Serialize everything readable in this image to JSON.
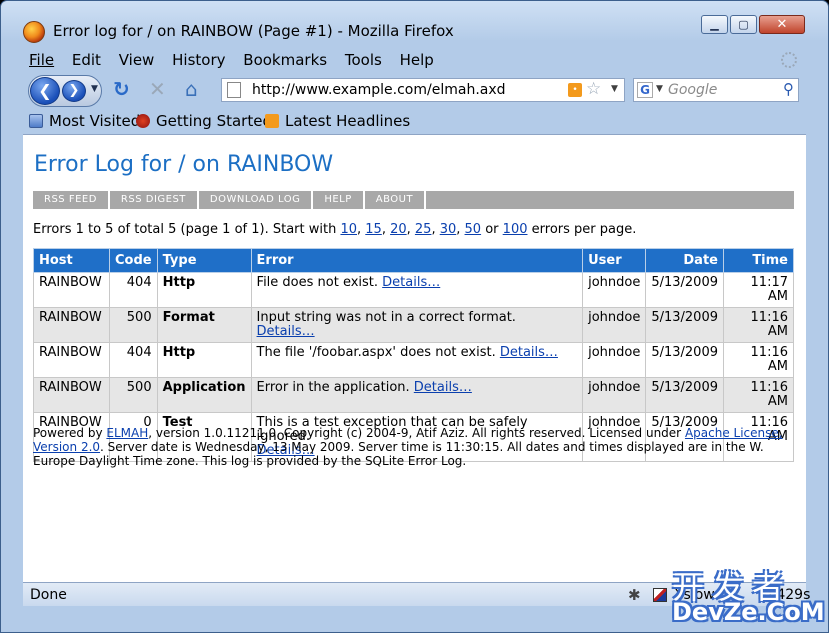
{
  "window": {
    "title": "Error log for / on RAINBOW (Page #1) - Mozilla Firefox",
    "minimize": "▁",
    "maximize": "▢",
    "close": "✕"
  },
  "menu": {
    "file": "File",
    "edit": "Edit",
    "view": "View",
    "history": "History",
    "bookmarks": "Bookmarks",
    "tools": "Tools",
    "help": "Help"
  },
  "navbar": {
    "url": "http://www.example.com/elmah.axd",
    "search_placeholder": "Google",
    "icons": {
      "back": "back-arrow-icon",
      "forward": "forward-arrow-icon",
      "reload": "reload-icon",
      "stop": "stop-icon",
      "home": "home-icon",
      "rss": "rss-feed-icon",
      "star": "bookmark-star-icon",
      "search_engine": "google-icon",
      "search": "magnifier-icon"
    }
  },
  "bookmarks_bar": {
    "most_visited": "Most Visited",
    "getting_started": "Getting Started",
    "latest_headlines": "Latest Headlines"
  },
  "page": {
    "title": "Error Log for / on RAINBOW",
    "nav": {
      "rss_feed": "RSS FEED",
      "rss_digest": "RSS DIGEST",
      "download_log": "DOWNLOAD LOG",
      "help": "HELP",
      "about": "ABOUT"
    },
    "summary": {
      "prefix": "Errors 1 to 5 of total 5 (page 1 of 1). Start with",
      "sizes": [
        "10",
        "15",
        "20",
        "25",
        "30",
        "50",
        "100"
      ],
      "or": "or",
      "suffix": "errors per page."
    },
    "table": {
      "headers": {
        "host": "Host",
        "code": "Code",
        "type": "Type",
        "error": "Error",
        "user": "User",
        "date": "Date",
        "time": "Time"
      },
      "details_label": "Details…",
      "rows": [
        {
          "host": "RAINBOW",
          "code": "404",
          "type": "Http",
          "error": "File does not exist.",
          "user": "johndoe",
          "date": "5/13/2009",
          "time": "11:17 AM"
        },
        {
          "host": "RAINBOW",
          "code": "500",
          "type": "Format",
          "error": "Input string was not in a correct format.",
          "user": "johndoe",
          "date": "5/13/2009",
          "time": "11:16 AM"
        },
        {
          "host": "RAINBOW",
          "code": "404",
          "type": "Http",
          "error": "The file '/foobar.aspx' does not exist.",
          "user": "johndoe",
          "date": "5/13/2009",
          "time": "11:16 AM"
        },
        {
          "host": "RAINBOW",
          "code": "500",
          "type": "Application",
          "error": "Error in the application.",
          "user": "johndoe",
          "date": "5/13/2009",
          "time": "11:16 AM"
        },
        {
          "host": "RAINBOW",
          "code": "0",
          "type": "Test",
          "error": "This is a test exception that can be safely ignored.",
          "user": "johndoe",
          "date": "5/13/2009",
          "time": "11:16 AM"
        }
      ]
    },
    "footer": {
      "powered_by": "Powered by",
      "elmah_link": "ELMAH",
      "version_text": ", version 1.0.11211.0. Copyright (c) 2004-9, Atif Aziz. All rights reserved. Licensed under",
      "license_link": "Apache License, Version 2.0",
      "rest": ". Server date is Wednesday, 13 May 2009. Server time is 11:30:15. All dates and times displayed are in the W. Europe Daylight Time zone. This log is provided by the SQLite Error Log."
    }
  },
  "status": {
    "text": "Done",
    "speed": "Yslow",
    "time": "0.429s"
  },
  "watermark": {
    "line1": "开发者",
    "line2": "DevZe.CoM"
  }
}
